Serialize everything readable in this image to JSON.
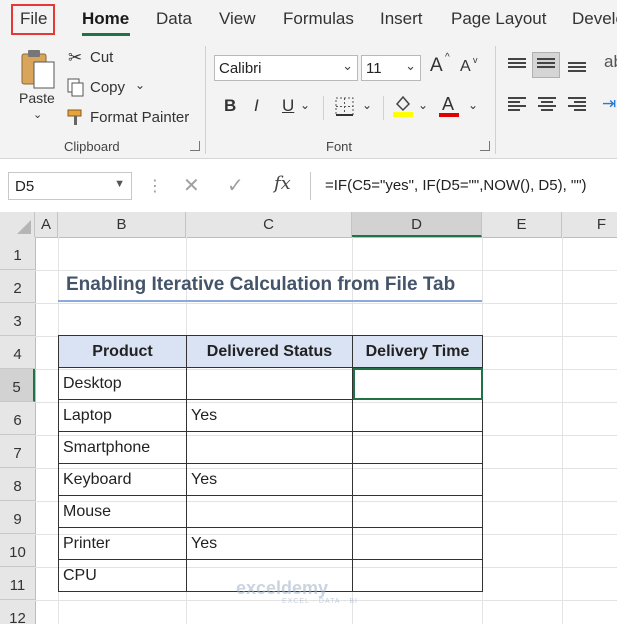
{
  "tabs": [
    "File",
    "Home",
    "Data",
    "View",
    "Formulas",
    "Insert",
    "Page Layout",
    "Develo"
  ],
  "clipboard": {
    "paste": "Paste",
    "cut": "Cut",
    "copy": "Copy",
    "format_painter": "Format Painter",
    "group_label": "Clipboard"
  },
  "font": {
    "name": "Calibri",
    "size": "11",
    "bold": "B",
    "italic": "I",
    "underline": "U",
    "font_color_glyph": "A",
    "grow": "A",
    "shrink": "A",
    "group_label": "Font",
    "highlight_color": "#ffff00",
    "font_color": "#e00000"
  },
  "formula_bar": {
    "name_box": "D5",
    "fx": "fx",
    "formula": "=IF(C5=\"yes\", IF(D5=\"\",NOW(), D5), \"\")"
  },
  "columns": [
    "A",
    "B",
    "C",
    "D",
    "E",
    "F"
  ],
  "rows": [
    "1",
    "2",
    "3",
    "4",
    "5",
    "6",
    "7",
    "8",
    "9",
    "10",
    "11",
    "12"
  ],
  "sheet": {
    "title": "Enabling Iterative Calculation from File Tab",
    "headers": [
      "Product",
      "Delivered Status",
      "Delivery Time"
    ],
    "data": [
      [
        "Desktop",
        "",
        ""
      ],
      [
        "Laptop",
        "Yes",
        ""
      ],
      [
        "Smartphone",
        "",
        ""
      ],
      [
        "Keyboard",
        "Yes",
        ""
      ],
      [
        "Mouse",
        "",
        ""
      ],
      [
        "Printer",
        "Yes",
        ""
      ],
      [
        "CPU",
        "",
        ""
      ]
    ]
  },
  "watermark": {
    "name": "exceldemy",
    "tagline": "EXCEL · DATA · BI"
  }
}
